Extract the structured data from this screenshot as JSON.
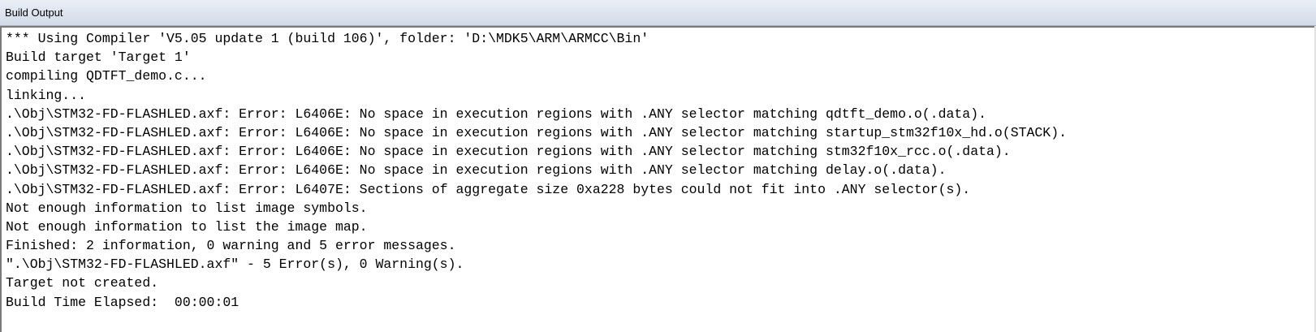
{
  "window": {
    "title": "Build Output"
  },
  "output": {
    "lines": [
      "*** Using Compiler 'V5.05 update 1 (build 106)', folder: 'D:\\MDK5\\ARM\\ARMCC\\Bin'",
      "Build target 'Target 1'",
      "compiling QDTFT_demo.c...",
      "linking...",
      ".\\Obj\\STM32-FD-FLASHLED.axf: Error: L6406E: No space in execution regions with .ANY selector matching qdtft_demo.o(.data).",
      ".\\Obj\\STM32-FD-FLASHLED.axf: Error: L6406E: No space in execution regions with .ANY selector matching startup_stm32f10x_hd.o(STACK).",
      ".\\Obj\\STM32-FD-FLASHLED.axf: Error: L6406E: No space in execution regions with .ANY selector matching stm32f10x_rcc.o(.data).",
      ".\\Obj\\STM32-FD-FLASHLED.axf: Error: L6406E: No space in execution regions with .ANY selector matching delay.o(.data).",
      ".\\Obj\\STM32-FD-FLASHLED.axf: Error: L6407E: Sections of aggregate size 0xa228 bytes could not fit into .ANY selector(s).",
      "Not enough information to list image symbols.",
      "Not enough information to list the image map.",
      "Finished: 2 information, 0 warning and 5 error messages.",
      "\".\\Obj\\STM32-FD-FLASHLED.axf\" - 5 Error(s), 0 Warning(s).",
      "Target not created.",
      "Build Time Elapsed:  00:00:01"
    ]
  }
}
